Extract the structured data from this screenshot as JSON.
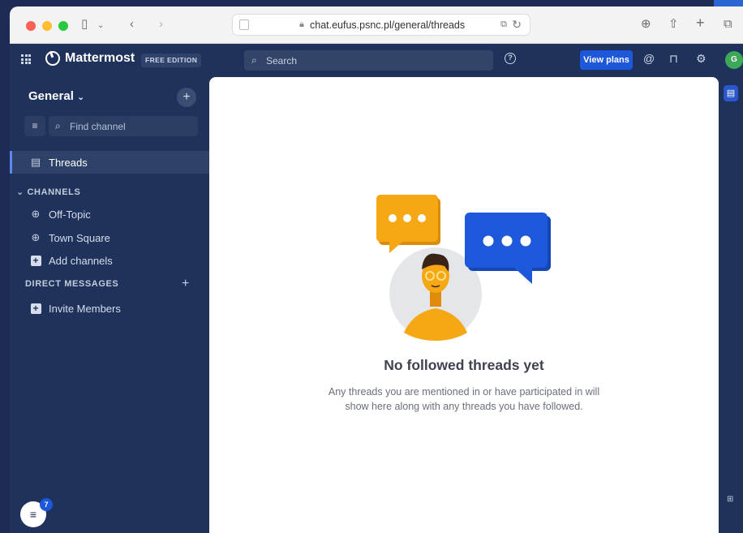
{
  "browser": {
    "url": "chat.eufus.psnc.pl/general/threads"
  },
  "topbar": {
    "product": "Mattermost",
    "edition": "FREE EDITION",
    "search_placeholder": "Search",
    "view_plans": "View plans",
    "avatar_initial": "G"
  },
  "sidebar": {
    "team_name": "General",
    "find_channel": "Find channel",
    "threads": "Threads",
    "channels_header": "CHANNELS",
    "channels": [
      {
        "label": "Off-Topic"
      },
      {
        "label": "Town Square"
      }
    ],
    "add_channels": "Add channels",
    "dm_header": "DIRECT MESSAGES",
    "invite_members": "Invite Members",
    "threads_badge": "7"
  },
  "main": {
    "empty_title": "No followed threads yet",
    "empty_desc": "Any threads you are mentioned in or have participated in will show here along with any threads you have followed."
  },
  "colors": {
    "sidebar_bg": "#1e325c",
    "accent": "#1c58d9",
    "bubble_yellow": "#f5a814",
    "bubble_blue": "#1c58d9"
  }
}
